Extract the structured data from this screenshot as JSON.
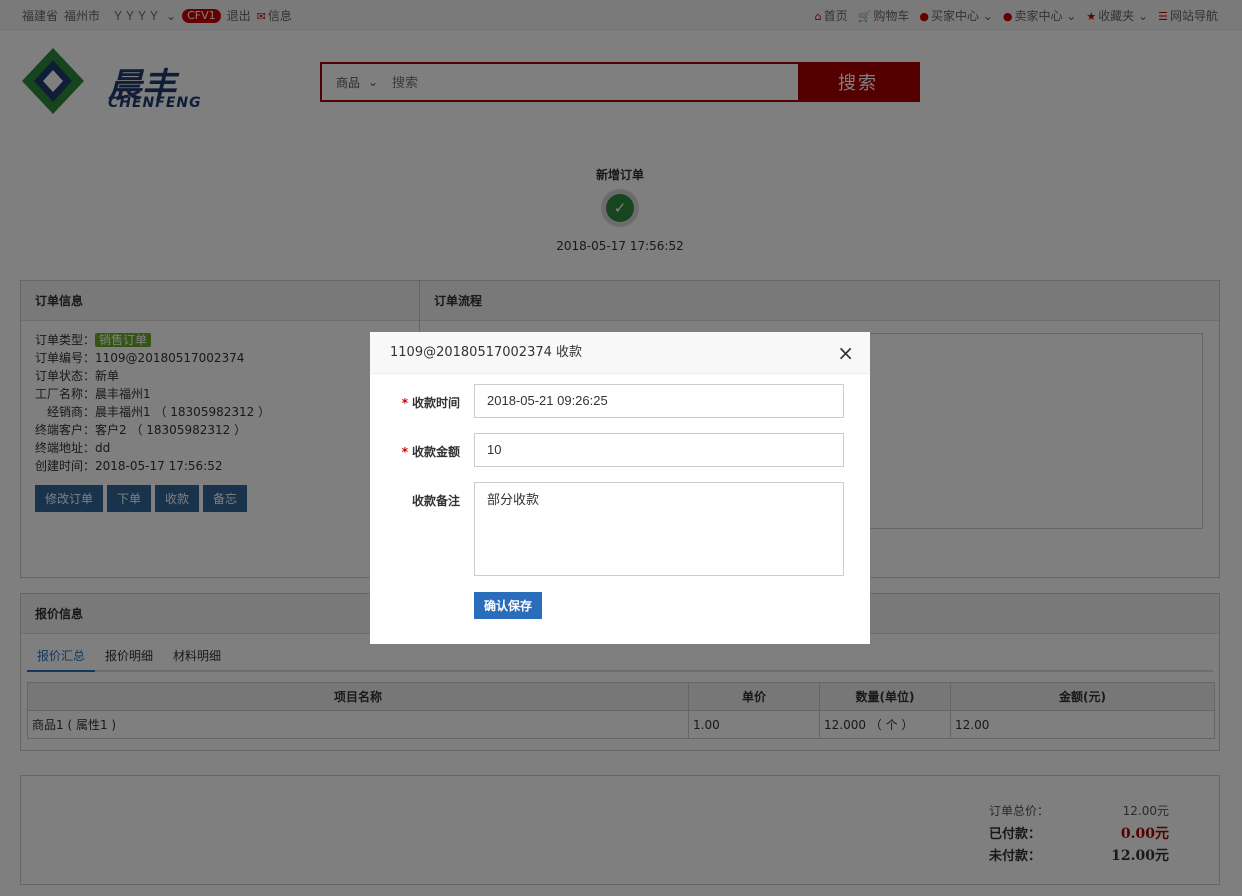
{
  "topbar": {
    "province": "福建省",
    "city": "福州市",
    "username": "ＹＹＹＹ",
    "level": "CFV1",
    "logout": "退出",
    "messages": "信息",
    "nav": [
      "首页",
      "购物车",
      "买家中心",
      "卖家中心",
      "收藏夹",
      "网站导航"
    ]
  },
  "logo": {
    "cn": "晨丰",
    "en": "CHENFENG"
  },
  "search": {
    "category": "商品",
    "placeholder": "搜索",
    "button": "搜索"
  },
  "status": {
    "title": "新增订单",
    "time": "2018-05-17 17:56:52"
  },
  "order_info": {
    "heading": "订单信息",
    "rows": [
      {
        "label": "订单类型：",
        "value": "销售订单"
      },
      {
        "label": "订单编号：",
        "value": "1109@20180517002374"
      },
      {
        "label": "订单状态：",
        "value": "新单"
      },
      {
        "label": "工厂名称：",
        "value": "晨丰福州1"
      },
      {
        "label": "经销商：",
        "value": "晨丰福州1 （ 18305982312 ）"
      },
      {
        "label": "终端客户：",
        "value": "客户2 （ 18305982312 ）"
      },
      {
        "label": "终端地址：",
        "value": "dd"
      },
      {
        "label": "创建时间：",
        "value": "2018-05-17 17:56:52"
      }
    ],
    "buttons": [
      "修改订单",
      "下单",
      "收款",
      "备忘"
    ]
  },
  "order_flow": {
    "heading": "订单流程"
  },
  "quote": {
    "heading": "报价信息",
    "tabs": [
      "报价汇总",
      "报价明细",
      "材料明细"
    ],
    "columns": [
      "项目名称",
      "单价",
      "数量(单位)",
      "金额(元)"
    ],
    "rows": [
      [
        "商品1 ( 属性1 )",
        "1.00",
        "12.000 （ 个 ）",
        "12.00"
      ]
    ]
  },
  "totals": {
    "total_label": "订单总价：",
    "total": "12.00元",
    "paid_label": "已付款：",
    "paid": "0.00元",
    "unpaid_label": "未付款：",
    "unpaid": "12.00元"
  },
  "modal": {
    "title": "1109@20180517002374 收款",
    "time_label": "收款时间",
    "time_value": "2018-05-21 09:26:25",
    "amount_label": "收款金额",
    "amount_value": "10",
    "note_label": "收款备注",
    "note_value": "部分收款",
    "save": "确认保存"
  }
}
